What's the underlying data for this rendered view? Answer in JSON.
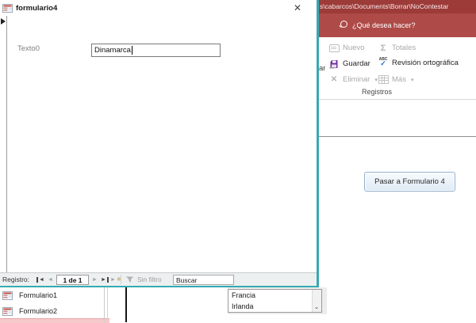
{
  "icons": {
    "close": "✕",
    "sum": "Σ",
    "delete_x": "✕",
    "caret": "▾",
    "abc": "ABC",
    "check": "✓",
    "chevron_down": "⌄",
    "asterisk": "✱",
    "tri_left": "◄",
    "tri_right": "►"
  },
  "window": {
    "path_text": "s\\cabarcos\\Documents\\Borrar\\NoContestar",
    "tellme": "¿Qué desea hacer?"
  },
  "ribbon": {
    "group_label": "Registros",
    "clipped_text": "ar",
    "buttons": {
      "nuevo": "Nuevo",
      "totales": "Totales",
      "guardar": "Guardar",
      "revision": "Revisión ortográfica",
      "eliminar": "Eliminar",
      "mas": "Más"
    }
  },
  "dialog": {
    "title": "formulario4",
    "field_label": "Texto0",
    "field_value": "Dinamarca",
    "nav": {
      "label": "Registro:",
      "position": "1 de 1",
      "filter_label": "Sin filtro",
      "search_text": "Buscar"
    }
  },
  "workspace": {
    "action_button": "Pasar a Formulario 4"
  },
  "nav_pane": {
    "items": [
      {
        "label": "Formulario1"
      },
      {
        "label": "Formulario2"
      }
    ]
  },
  "listbox": {
    "items": [
      {
        "label": "Francia"
      },
      {
        "label": "Irlanda"
      }
    ]
  },
  "colors": {
    "titlebar_red": "#9d3b39",
    "tellme_red": "#ae4a47",
    "dialog_border_teal": "#35aab1",
    "check_blue": "#2b6cd4",
    "save_purple": "#7030a0",
    "selection_pink": "#f6caca"
  }
}
